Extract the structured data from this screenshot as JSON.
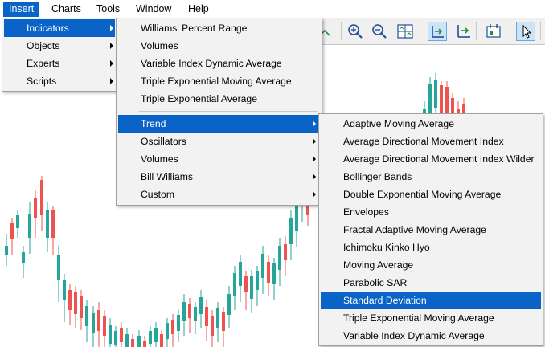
{
  "menubar": {
    "items": [
      {
        "label": "Insert",
        "active": true
      },
      {
        "label": "Charts",
        "active": false
      },
      {
        "label": "Tools",
        "active": false
      },
      {
        "label": "Window",
        "active": false
      },
      {
        "label": "Help",
        "active": false
      }
    ]
  },
  "insert_menu": {
    "items": [
      {
        "label": "Indicators",
        "has_submenu": true,
        "highlighted": true
      },
      {
        "label": "Objects",
        "has_submenu": true,
        "highlighted": false
      },
      {
        "label": "Experts",
        "has_submenu": true,
        "highlighted": false
      },
      {
        "label": "Scripts",
        "has_submenu": true,
        "highlighted": false
      }
    ]
  },
  "indicators_menu": {
    "items": [
      {
        "label": "Williams' Percent Range",
        "has_submenu": false,
        "highlighted": false
      },
      {
        "label": "Volumes",
        "has_submenu": false,
        "highlighted": false
      },
      {
        "label": "Variable Index Dynamic Average",
        "has_submenu": false,
        "highlighted": false
      },
      {
        "label": "Triple Exponential Moving Average",
        "has_submenu": false,
        "highlighted": false
      },
      {
        "label": "Triple Exponential Average",
        "has_submenu": false,
        "highlighted": false
      }
    ],
    "groups": [
      {
        "label": "Trend",
        "has_submenu": true,
        "highlighted": true
      },
      {
        "label": "Oscillators",
        "has_submenu": true,
        "highlighted": false
      },
      {
        "label": "Volumes",
        "has_submenu": true,
        "highlighted": false
      },
      {
        "label": "Bill Williams",
        "has_submenu": true,
        "highlighted": false
      },
      {
        "label": "Custom",
        "has_submenu": true,
        "highlighted": false
      }
    ]
  },
  "trend_menu": {
    "items": [
      {
        "label": "Adaptive Moving Average",
        "highlighted": false
      },
      {
        "label": "Average Directional Movement Index",
        "highlighted": false
      },
      {
        "label": "Average Directional Movement Index Wilder",
        "highlighted": false
      },
      {
        "label": "Bollinger Bands",
        "highlighted": false
      },
      {
        "label": "Double Exponential Moving Average",
        "highlighted": false
      },
      {
        "label": "Envelopes",
        "highlighted": false
      },
      {
        "label": "Fractal Adaptive Moving Average",
        "highlighted": false
      },
      {
        "label": "Ichimoku Kinko Hyo",
        "highlighted": false
      },
      {
        "label": "Moving Average",
        "highlighted": false
      },
      {
        "label": "Parabolic SAR",
        "highlighted": false
      },
      {
        "label": "Standard Deviation",
        "highlighted": true
      },
      {
        "label": "Triple Exponential Moving Average",
        "highlighted": false
      },
      {
        "label": "Variable Index Dynamic Average",
        "highlighted": false
      }
    ]
  },
  "toolbar": {
    "buttons": [
      {
        "icon": "line-chart-icon",
        "pressed": false
      },
      {
        "icon": "zoom-in-icon",
        "pressed": false
      },
      {
        "icon": "zoom-out-icon",
        "pressed": false
      },
      {
        "icon": "tile-windows-icon",
        "pressed": false
      },
      {
        "icon": "chart-shift-icon",
        "pressed": true
      },
      {
        "icon": "auto-scroll-icon",
        "pressed": false
      },
      {
        "icon": "period-separators-icon",
        "pressed": false
      },
      {
        "icon": "cursor-icon",
        "pressed": true
      }
    ]
  },
  "colors": {
    "bull": "#26a69a",
    "bear": "#ef5350",
    "highlight": "#0a64c8",
    "menu_bg": "#f2f2f2"
  }
}
